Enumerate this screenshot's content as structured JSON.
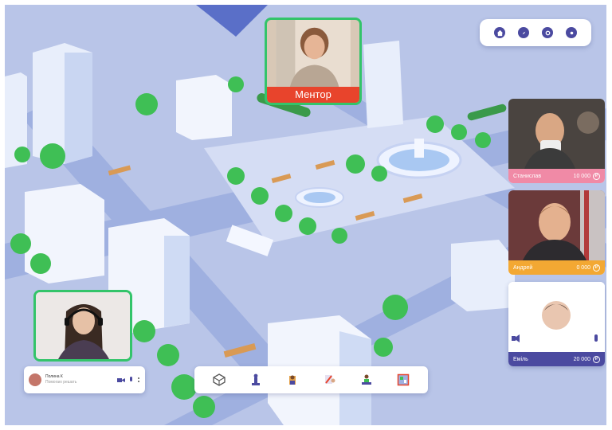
{
  "mentor": {
    "label": "Ментор"
  },
  "participants": [
    {
      "name": "Станислав",
      "points": "10 000",
      "bar_color": "#f08aa6",
      "coin": "₽"
    },
    {
      "name": "Андрей",
      "points": "0 000",
      "bar_color": "#f3a833",
      "coin": "₽"
    },
    {
      "name": "Еміль",
      "points": "20 000",
      "bar_color": "#4b4aa0",
      "coin": "₽"
    }
  ],
  "current_user": {
    "name": "Полина К",
    "status": "Помогаю решать"
  },
  "nav_icons": [
    "home-icon",
    "compass-icon",
    "settings-icon",
    "logout-icon"
  ],
  "toolbar_icons": [
    "cube-icon",
    "figure-icon",
    "character-icon",
    "painter-icon",
    "person-table-icon",
    "map-icon"
  ],
  "colors": {
    "accent": "#4b4aa0",
    "mentor_label": "#e8442c",
    "frame": "#33c46a",
    "background": "#b7c3e6"
  }
}
